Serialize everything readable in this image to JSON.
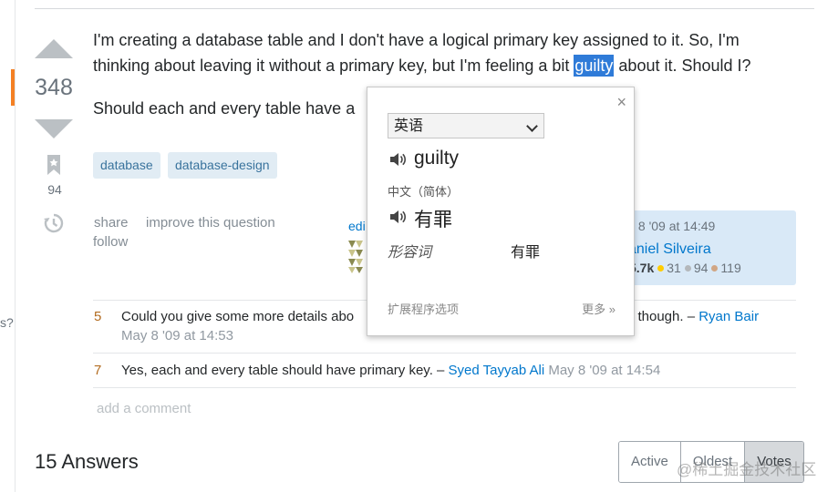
{
  "question": {
    "votes": "348",
    "favorites": "94",
    "body_line1": "I'm creating a database table and I don't have a logical primary key assigned to it. So, I'm",
    "body_line2_before": "thinking about leaving it without a primary key, but I'm feeling a bit ",
    "body_highlight": "guilty",
    "body_line2_after": " about it. Should I?",
    "body_line3": "Should each and every table have a",
    "tags": [
      "database",
      "database-design"
    ],
    "menu": {
      "share": "share",
      "improve": "improve this question",
      "follow": "follow"
    },
    "edited_prefix": "edi",
    "owner": {
      "date": "y 8 '09 at 14:49",
      "name": "aniel Silveira",
      "rep": "5.7k",
      "gold": "31",
      "silver": "94",
      "bronze": "119"
    },
    "left_stub": "s?"
  },
  "comments": [
    {
      "score": "5",
      "text_a": "Could you give some more details abo",
      "text_b": "es\" though. – ",
      "user": "Ryan Bair",
      "date": "May 8 '09 at 14:53"
    },
    {
      "score": "7",
      "text": "Yes, each and every table should have primary key. – ",
      "user": "Syed Tayyab Ali",
      "date": " May 8 '09 at 14:54"
    }
  ],
  "add_comment": "add a comment",
  "answers": {
    "title": "15 Answers",
    "sort": [
      "Active",
      "Oldest",
      "Votes"
    ]
  },
  "popup": {
    "close": "×",
    "source_lang": "英语",
    "source_word": "guilty",
    "target_lang": "中文（简体）",
    "target_word": "有罪",
    "pos": "形容词",
    "pos_value": "有罪",
    "extension_options": "扩展程序选项",
    "more": "更多 »"
  },
  "watermark": "@稀土掘金技术社区",
  "colors": {
    "accent": "#f48024",
    "link": "#0077cc",
    "highlight": "#2f7bd8",
    "tag_bg": "#e1ecf4",
    "owner_bg": "#d9e9f7"
  }
}
